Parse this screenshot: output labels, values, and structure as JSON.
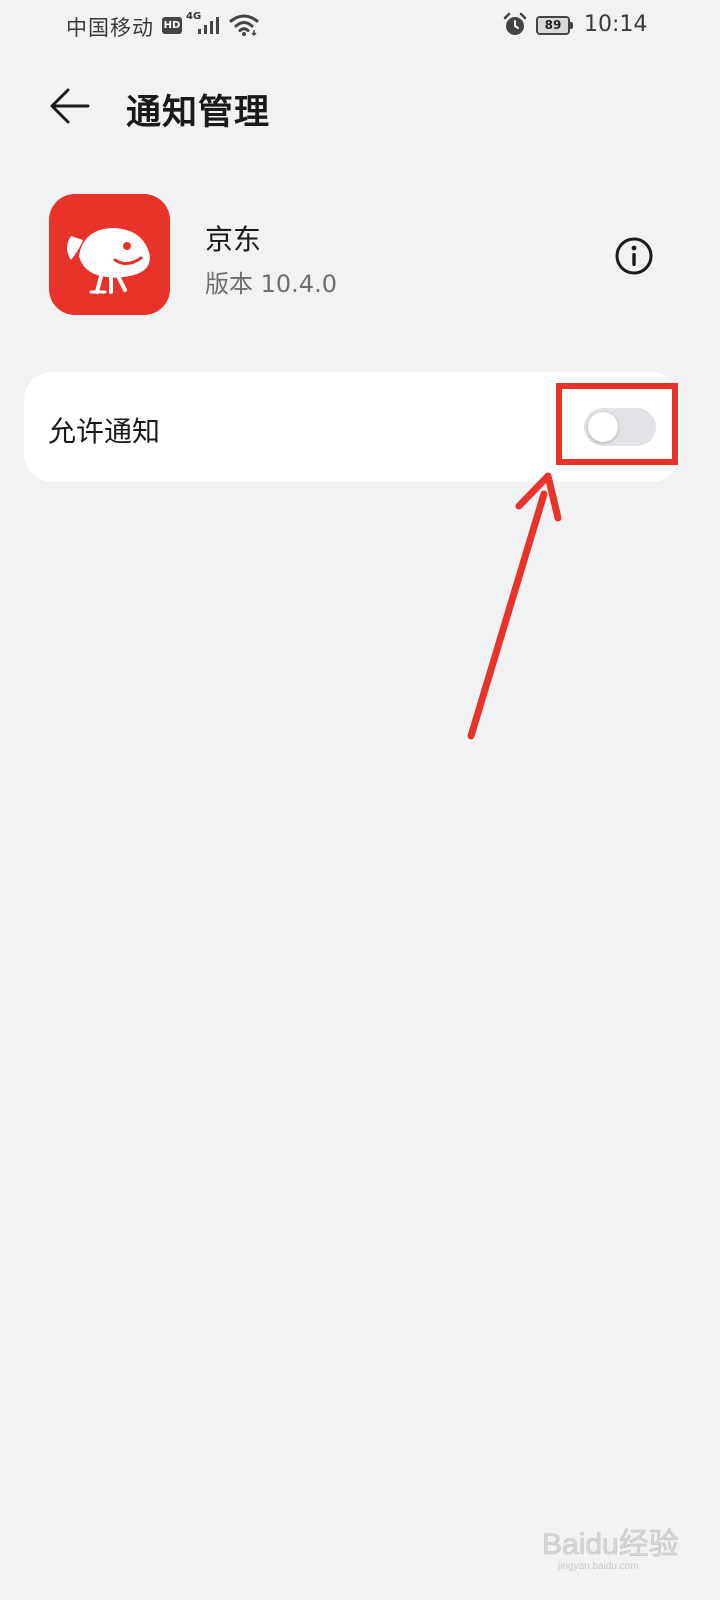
{
  "status_bar": {
    "carrier": "中国移动",
    "hd_badge": "HD",
    "network_type": "4G",
    "battery_level": "89",
    "time": "10:14"
  },
  "header": {
    "title": "通知管理",
    "back_icon": "arrow-left-icon"
  },
  "app": {
    "name": "京东",
    "version": "版本 10.4.0",
    "icon": "jd-logo-icon",
    "info_icon": "info-circle-icon",
    "brand_color": "#e8322a"
  },
  "settings": {
    "allow_notifications": {
      "label": "允许通知",
      "enabled": false
    }
  },
  "annotation": {
    "color": "#e8322a"
  },
  "watermark": {
    "text": "Baidu经验",
    "subtext": "jingyan.baidu.com"
  }
}
